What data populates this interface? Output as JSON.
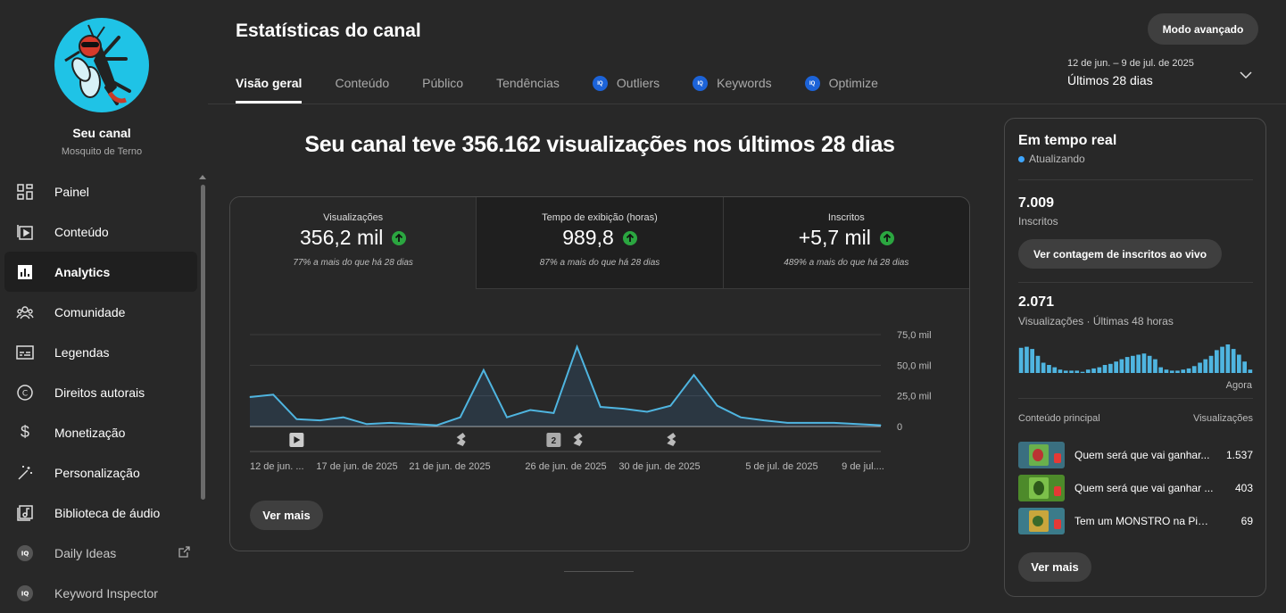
{
  "channel": {
    "name": "Seu canal",
    "handle": "Mosquito de Terno"
  },
  "sidebar": {
    "items": [
      {
        "label": "Painel",
        "icon": "dashboard-icon"
      },
      {
        "label": "Conteúdo",
        "icon": "content-icon"
      },
      {
        "label": "Analytics",
        "icon": "analytics-icon",
        "active": true
      },
      {
        "label": "Comunidade",
        "icon": "community-icon"
      },
      {
        "label": "Legendas",
        "icon": "subtitles-icon"
      },
      {
        "label": "Direitos autorais",
        "icon": "copyright-icon"
      },
      {
        "label": "Monetização",
        "icon": "dollar-icon"
      },
      {
        "label": "Personalização",
        "icon": "magic-wand-icon"
      },
      {
        "label": "Biblioteca de áudio",
        "icon": "audio-library-icon"
      },
      {
        "label": "Daily Ideas",
        "icon": "vidiq-icon"
      },
      {
        "label": "Keyword Inspector",
        "icon": "vidiq-icon"
      }
    ]
  },
  "header": {
    "title": "Estatísticas do canal",
    "advanced_mode": "Modo avançado",
    "date_range": "12 de jun. – 9 de jul. de 2025",
    "period": "Últimos 28 dias"
  },
  "tabs": [
    {
      "label": "Visão geral",
      "active": true
    },
    {
      "label": "Conteúdo"
    },
    {
      "label": "Público"
    },
    {
      "label": "Tendências"
    },
    {
      "label": "Outliers",
      "badge": "vidiq"
    },
    {
      "label": "Keywords",
      "badge": "vidiq"
    },
    {
      "label": "Optimize",
      "badge": "vidiq"
    }
  ],
  "headline": "Seu canal teve 356.162 visualizações nos últimos 28 dias",
  "metrics": [
    {
      "label": "Visualizações",
      "value": "356,2 mil",
      "sub": "77% a mais do que há 28 dias"
    },
    {
      "label": "Tempo de exibição (horas)",
      "value": "989,8",
      "sub": "87% a mais do que há 28 dias"
    },
    {
      "label": "Inscritos",
      "value": "+5,7 mil",
      "sub": "489% a mais do que há 28 dias"
    }
  ],
  "chart_data": {
    "type": "line",
    "ylim": [
      0,
      75000
    ],
    "yticks": [
      "0",
      "25,0 mil",
      "50,0 mil",
      "75,0 mil"
    ],
    "xticks": [
      "12 de jun. ...",
      "17 de jun. de 2025",
      "21 de jun. de 2025",
      "26 de jun. de 2025",
      "30 de jun. de 2025",
      "5 de jul. de 2025",
      "9 de jul...."
    ],
    "values": [
      24000,
      26000,
      6000,
      5000,
      7500,
      2000,
      3000,
      2000,
      1000,
      7500,
      46000,
      7500,
      13500,
      11000,
      65000,
      16000,
      14500,
      12000,
      17000,
      42000,
      17000,
      7500,
      5000,
      3000,
      3000,
      3000,
      2000,
      1000
    ],
    "markers": [
      "video",
      "short",
      "2",
      "short",
      "short"
    ]
  },
  "see_more": "Ver mais",
  "realtime": {
    "title": "Em tempo real",
    "status": "Atualizando",
    "subscribers": "7.009",
    "subscribers_label": "Inscritos",
    "live_button": "Ver contagem de inscritos ao vivo",
    "views": "2.071",
    "views_label": "Visualizações · Últimas 48 horas",
    "now_label": "Agora",
    "bars": [
      22,
      23,
      21,
      15,
      9,
      7,
      5,
      3,
      2,
      2,
      2,
      1,
      3,
      4,
      5,
      7,
      8,
      10,
      12,
      14,
      15,
      16,
      17,
      15,
      12,
      5,
      3,
      2,
      2,
      3,
      4,
      6,
      9,
      12,
      15,
      20,
      23,
      25,
      21,
      16,
      10,
      3
    ],
    "top_content_label": "Conteúdo principal",
    "top_views_label": "Visualizações",
    "top_content": [
      {
        "title": "Quem será que vai ganhar...",
        "value": "1.537",
        "color": "#3a6f80"
      },
      {
        "title": "Quem será que vai ganhar ...",
        "value": "403",
        "color": "#4d8a2a"
      },
      {
        "title": "Tem um MONSTRO na Piscina...",
        "value": "69",
        "color": "#3b7b8a"
      }
    ],
    "see_more": "Ver mais"
  }
}
